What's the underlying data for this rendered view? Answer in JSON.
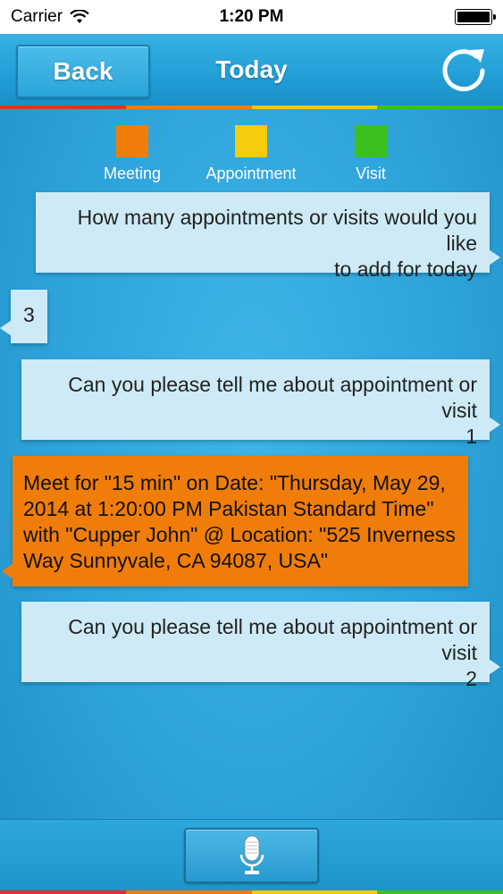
{
  "status_bar": {
    "carrier": "Carrier",
    "time": "1:20 PM"
  },
  "nav": {
    "back_label": "Back",
    "title": "Today",
    "refresh_icon": "refresh-icon"
  },
  "legend": [
    {
      "label": "Meeting",
      "color": "#f07d0a"
    },
    {
      "label": "Appointment",
      "color": "#f7cc0c"
    },
    {
      "label": "Visit",
      "color": "#3cc11c"
    }
  ],
  "messages": [
    {
      "sender": "app",
      "color": "#cdeaf6",
      "lines": [
        "How many appointments or visits would you like",
        "to add for today"
      ]
    },
    {
      "sender": "user",
      "color": "#cdeaf6",
      "lines": [
        "3"
      ]
    },
    {
      "sender": "app",
      "color": "#cdeaf6",
      "lines": [
        "Can you please tell me about appointment or visit",
        "1"
      ]
    },
    {
      "sender": "user",
      "color": "#f07d0a",
      "lines": [
        "Meet  for \"15 min\" on Date: \"Thursday, May 29,",
        "2014 at 1:20:00 PM Pakistan Standard Time\"",
        "with \"Cupper John\" @ Location: \"525 Inverness",
        "Way Sunnyvale, CA 94087, USA\""
      ]
    },
    {
      "sender": "app",
      "color": "#cdeaf6",
      "lines": [
        "Can you please tell me about appointment or visit",
        "2"
      ]
    }
  ],
  "bottom_bar": {
    "mic_icon": "microphone-icon"
  },
  "colors": {
    "strip": [
      "#e0322a",
      "#f07d0a",
      "#f7cc0c",
      "#3cc11c"
    ]
  }
}
